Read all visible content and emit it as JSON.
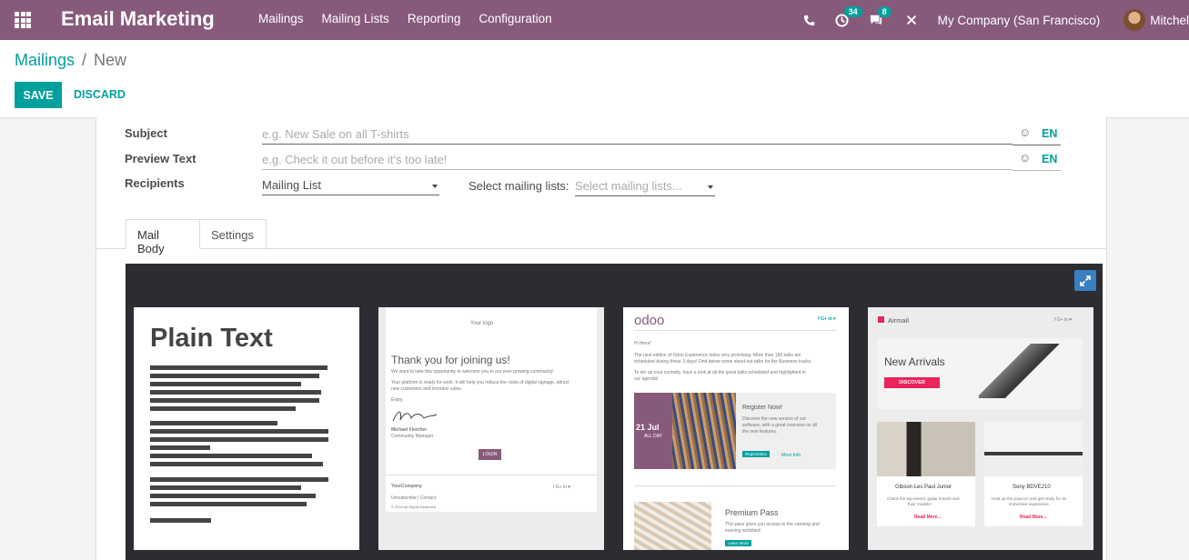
{
  "navbar": {
    "app_title": "Email Marketing",
    "menu": [
      "Mailings",
      "Mailing Lists",
      "Reporting",
      "Configuration"
    ],
    "activity_count": "34",
    "message_count": "8",
    "company": "My Company (San Francisco)",
    "user": "Mitchel"
  },
  "breadcrumb": {
    "parent": "Mailings",
    "separator": "/",
    "current": "New"
  },
  "buttons": {
    "save": "SAVE",
    "discard": "DISCARD"
  },
  "form": {
    "subject_label": "Subject",
    "subject_placeholder": "e.g. New Sale on all T-shirts",
    "preview_label": "Preview Text",
    "preview_placeholder": "e.g. Check it out before it's too late!",
    "lang": "EN",
    "recipients_label": "Recipients",
    "recipients_value": "Mailing List",
    "mailing_lists_label": "Select mailing lists:",
    "mailing_lists_placeholder": "Select mailing lists..."
  },
  "tabs": [
    "Mail Body",
    "Settings"
  ],
  "templates": {
    "plain_text": {
      "title": "Plain Text"
    },
    "welcome": {
      "logo": "Your logo",
      "heading": "Thank you for joining us!",
      "line1": "We want to take this opportunity to welcome you to our ever-growing community!",
      "line2": "Your platform is ready for work. It will help you reduce the costs of digital signage, attract",
      "line3": "new customers and increase sales.",
      "enjoy": "Enjoy,",
      "signer": "Michael Fletcher",
      "signer_role": "Community Manager",
      "login": "LOGIN",
      "company": "YourCompany",
      "links": "Unsubscribe | Contact",
      "copyright": "© 2020 All Rights Reserved",
      "social": "f  G+  in  ♥"
    },
    "odoo": {
      "logo": "odoo",
      "social": "f  G+  in  ♥",
      "greeting": "Hi there!",
      "intro1": "The next edition of Odoo Experience looks very promising. More than 150 talks are",
      "intro2": "scheduled during those 3 days! Find below some stand-out talks for the Business tracks.",
      "intro3": "To stir up your curiosity, have a look at all the great talks scheduled and highlighted in",
      "intro4": "our agenda!",
      "date": "21 Jul",
      "date_sub": "ALL DAY",
      "register_title": "Register Now!",
      "register_text1": "Discover the new version of our",
      "register_text2": "software, with a great overview on all",
      "register_text3": "the new features.",
      "registration_btn": "Registration",
      "more_info": "More Info",
      "premium_title": "Premium Pass",
      "premium_text1": "This pass gives you access to the catering and",
      "premium_text2": "evening activities!",
      "premium_btn": "Learn More"
    },
    "airmail": {
      "logo": "Airmail",
      "social": "f  G+  in  ♥",
      "hero_title": "New Arrivals",
      "discover": "DISCOVER",
      "item1_title": "Gibson Les Paul Junior",
      "item1_text1": "Check the top electric guitar brands and",
      "item1_text2": "their models!",
      "item2_title": "Sony BDVE210",
      "item2_text1": "Heat up the popcorn and get ready for an",
      "item2_text2": "immersive experience.",
      "read_more": "Read More..."
    }
  }
}
